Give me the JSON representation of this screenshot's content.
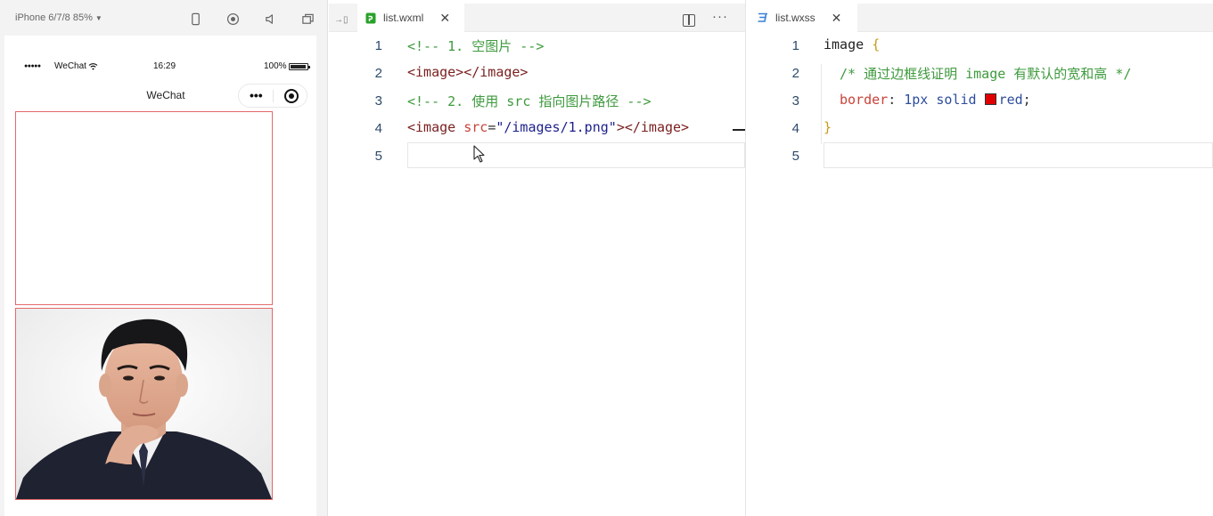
{
  "simulator": {
    "device_label": "iPhone 6/7/8 85%",
    "status": {
      "signal": "●●●●●",
      "carrier": "WeChat",
      "time": "16:29",
      "battery_pct": "100%"
    },
    "nav_title": "WeChat",
    "capsule_more": "•••"
  },
  "editor_left": {
    "tab": {
      "filename": "list.wxml",
      "icon": "wxml-file-icon",
      "close": "✕"
    },
    "more": "···",
    "line_numbers": [
      "1",
      "2",
      "3",
      "4",
      "5"
    ],
    "lines": [
      {
        "comment": "<!-- 1. 空图片 -->"
      },
      {
        "open": "<image>",
        "close": "</image>"
      },
      {
        "comment": "<!-- 2. 使用 src 指向图片路径 -->"
      },
      {
        "tag_start": "<image ",
        "attr": "src",
        "eq": "=",
        "value": "\"/images/1.png\"",
        "tag_end": "></image>"
      },
      {
        "empty": ""
      }
    ]
  },
  "editor_right": {
    "tab": {
      "filename": "list.wxss",
      "icon": "css-file-icon",
      "close": "✕"
    },
    "line_numbers": [
      "1",
      "2",
      "3",
      "4",
      "5"
    ],
    "lines": [
      {
        "selector": "image",
        "brace": "{"
      },
      {
        "comment": "/* 通过边框线证明 image 有默认的宽和高 */"
      },
      {
        "property": "border",
        "colon": ":",
        "v1": "1px",
        "v2": "solid",
        "color": "red",
        "semi": ";"
      },
      {
        "brace": "}"
      },
      {
        "empty": ""
      }
    ],
    "swatch_color": "#e00000"
  },
  "colors": {
    "comment": "#3e9a3e",
    "tag": "#7a1f1f",
    "attr": "#c8433a",
    "string": "#1c1f8c",
    "image_border": "#e36a6a"
  }
}
